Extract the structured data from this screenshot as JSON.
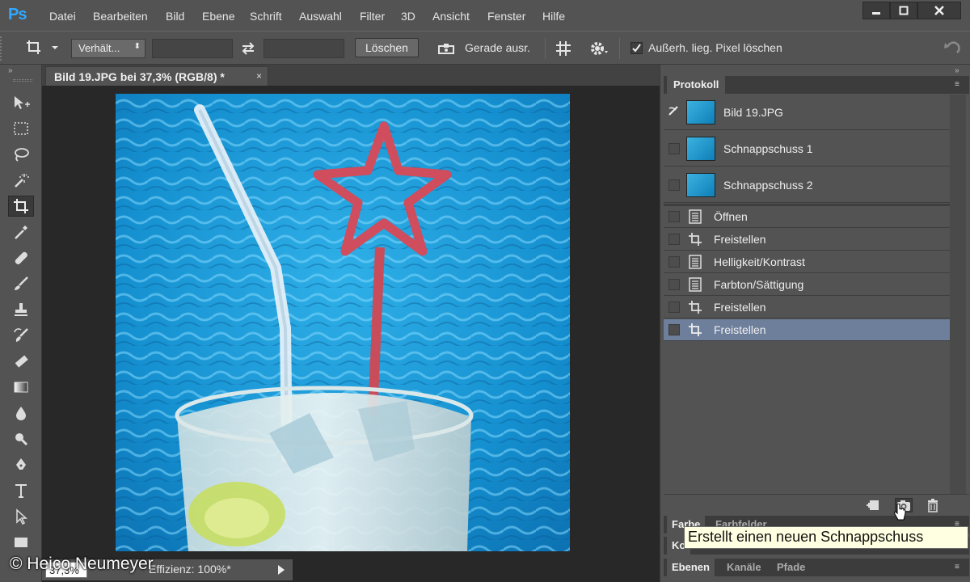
{
  "app": {
    "logo": "Ps"
  },
  "menu": [
    "Datei",
    "Bearbeiten",
    "Bild",
    "Ebene",
    "Schrift",
    "Auswahl",
    "Filter",
    "3D",
    "Ansicht",
    "Fenster",
    "Hilfe"
  ],
  "options": {
    "ratio_select": "Verhält...",
    "clear_button": "Löschen",
    "straighten_label": "Gerade ausr.",
    "delete_pixels_label": "Außerh. lieg. Pixel löschen",
    "delete_pixels_checked": true
  },
  "document": {
    "tab_title": "Bild 19.JPG bei 37,3% (RGB/8) *",
    "close_glyph": "×"
  },
  "status": {
    "zoom": "37,3%",
    "text": "Effizienz: 100%*"
  },
  "watermark": "© Heico Neumeyer",
  "panel": {
    "title": "Protokoll",
    "snapshots": [
      {
        "label": "Bild 19.JPG",
        "source": true
      },
      {
        "label": "Schnappschuss 1"
      },
      {
        "label": "Schnappschuss 2"
      }
    ],
    "states": [
      {
        "label": "Öffnen",
        "icon": "document-icon"
      },
      {
        "label": "Freistellen",
        "icon": "crop-icon"
      },
      {
        "label": "Helligkeit/Kontrast",
        "icon": "document-icon"
      },
      {
        "label": "Farbton/Sättigung",
        "icon": "document-icon"
      },
      {
        "label": "Freistellen",
        "icon": "crop-icon"
      },
      {
        "label": "Freistellen",
        "icon": "crop-icon",
        "selected": true
      }
    ],
    "tooltip": "Erstellt einen neuen Schnappschuss"
  },
  "color_panel": {
    "tabs": [
      "Farbe",
      "Farbfelder"
    ]
  },
  "k_panel": {
    "tabs": [
      "Ko"
    ]
  },
  "layers_panel": {
    "tabs": [
      "Ebenen",
      "Kanäle",
      "Pfade"
    ]
  },
  "colors": {
    "selected_row": "#6e7f9c",
    "app_bg": "#535353",
    "ps_blue": "#31a8ff"
  }
}
